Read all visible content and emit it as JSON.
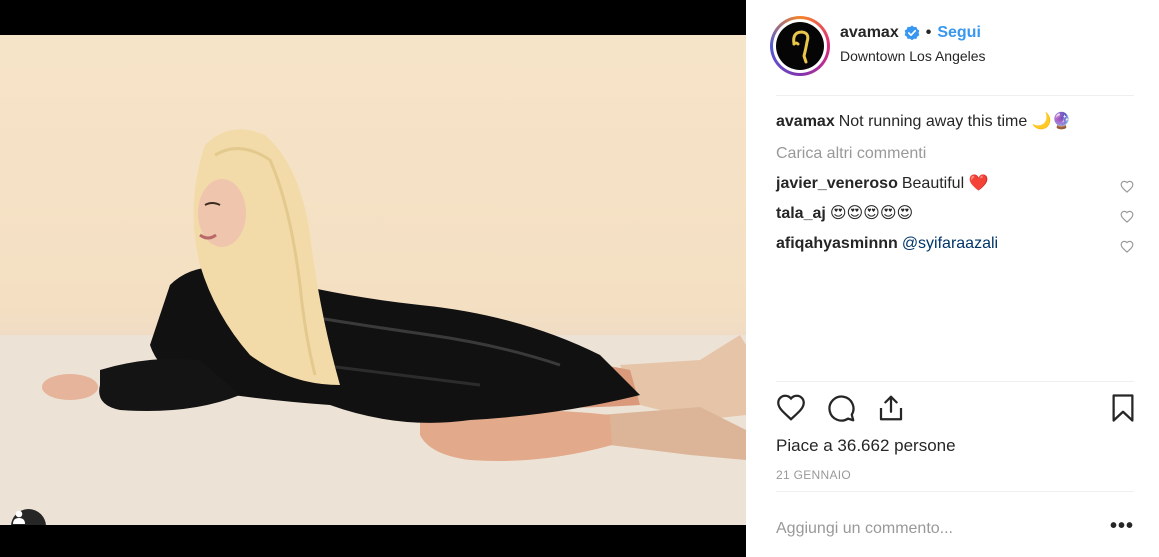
{
  "post": {
    "username": "avamax",
    "separator": "•",
    "follow_label": "Segui",
    "location": "Downtown Los Angeles",
    "caption_user": "avamax",
    "caption_text": "Not running away this time 🌙🔮",
    "load_more_label": "Carica altri commenti",
    "comments": [
      {
        "user": "javier_veneroso",
        "text": "Beautiful ❤️"
      },
      {
        "user": "tala_aj",
        "text": "😍😍😍😍😍"
      },
      {
        "user": "afiqahyasminnn",
        "mention": "@syifaraazali"
      }
    ],
    "likes_text": "Piace a 36.662 persone",
    "date": "21 GENNAIO",
    "add_comment_placeholder": "Aggiungi un commento...",
    "more_options": "•••"
  },
  "colors": {
    "follow": "#3897f0",
    "verified": "#3897f0",
    "muted": "#999999",
    "mention": "#003569"
  },
  "icons": {
    "verified": "verified-badge-icon",
    "like": "heart-icon",
    "comment": "comment-bubble-icon",
    "share": "share-icon",
    "save": "bookmark-icon",
    "user_tag": "user-icon"
  }
}
